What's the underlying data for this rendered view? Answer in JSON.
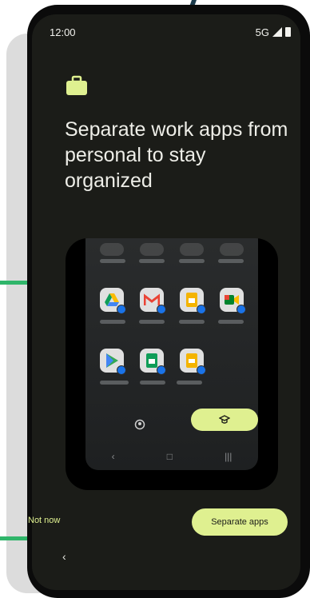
{
  "status_bar": {
    "time": "12:00",
    "network": "5G",
    "signal_icon": "signal-icon",
    "battery_icon": "battery-icon"
  },
  "header": {
    "icon": "briefcase-icon",
    "title": "Separate work apps from personal to stay organized"
  },
  "illustration": {
    "apps_row_1": [
      "drive-icon",
      "gmail-icon",
      "docs-icon",
      "meet-icon"
    ],
    "apps_row_2": [
      "play-store-icon",
      "sheets-icon",
      "slides-icon"
    ],
    "tabs": [
      "personal-profile-icon",
      "work-profile-icon"
    ],
    "nav": {
      "back": "‹",
      "home": "□",
      "recents": "|||"
    }
  },
  "actions": {
    "secondary_label": "Not now",
    "primary_label": "Separate apps"
  },
  "system_nav": {
    "back": "‹"
  },
  "colors": {
    "accent": "#dff090",
    "background": "#1b1c18",
    "text": "#eeeee8"
  }
}
